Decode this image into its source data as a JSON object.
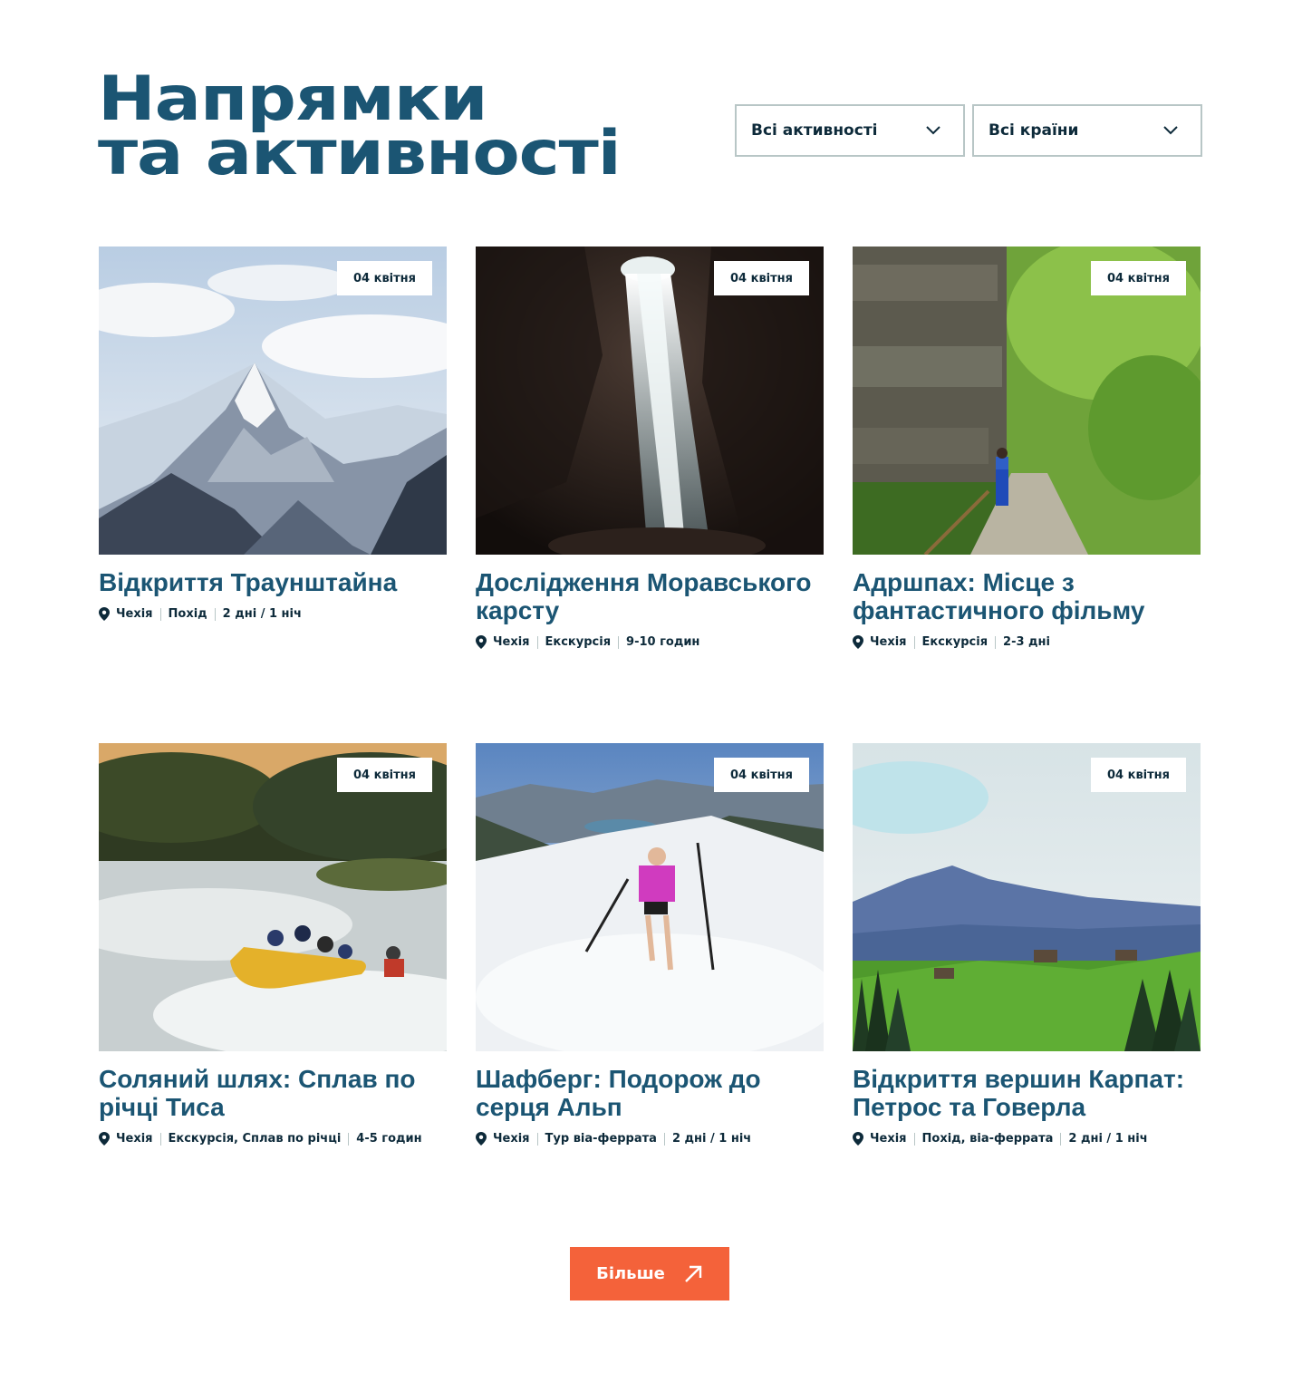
{
  "header": {
    "title_line1": "Напрямки",
    "title_line2": "та активності"
  },
  "filters": {
    "activity": "Всі активності",
    "country": "Всі країни"
  },
  "cards": [
    {
      "date": "04 квітня",
      "title": "Відкриття Траунштайна",
      "country": "Чехія",
      "type": "Похід",
      "duration": "2 дні / 1 ніч",
      "image": "snowy-mountain-peak"
    },
    {
      "date": "04 квітня",
      "title": "Дослідження Моравського карсту",
      "country": "Чехія",
      "type": "Екскурсія",
      "duration": "9-10 годин",
      "image": "cave-waterfall"
    },
    {
      "date": "04 квітня",
      "title": "Адршпах: Місце з фантастичного фільму",
      "country": "Чехія",
      "type": "Екскурсія",
      "duration": "2-3 дні",
      "image": "rock-forest-hiker"
    },
    {
      "date": "04 квітня",
      "title": "Соляний шлях: Сплав по річці Тиса",
      "country": "Чехія",
      "type": "Екскурсія, Сплав по річці",
      "duration": "4-5 годин",
      "image": "river-rafting"
    },
    {
      "date": "04 квітня",
      "title": "Шафберг: Подорож до серця Альп",
      "country": "Чехія",
      "type": "Тур віа-феррата",
      "duration": "2 дні / 1 ніч",
      "image": "snow-hiker-alps"
    },
    {
      "date": "04 квітня",
      "title": "Відкриття вершин Карпат: Петрос та Говерла",
      "country": "Чехія",
      "type": "Похід, віа-феррата",
      "duration": "2 дні / 1 ніч",
      "image": "carpathian-meadow"
    }
  ],
  "more_button": {
    "label": "Більше",
    "icon": "arrow-up-right-icon"
  },
  "colors": {
    "primary": "#1b5573",
    "accent": "#f4623a",
    "border": "#b8c6c6",
    "text_dark": "#0d2a3a"
  }
}
